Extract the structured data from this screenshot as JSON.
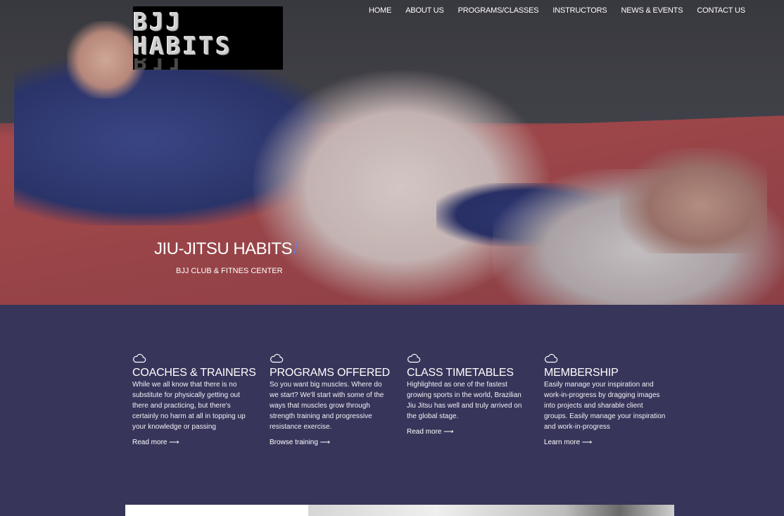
{
  "logo": {
    "text": "BJJ HABITS"
  },
  "nav": {
    "items": [
      "HOME",
      "ABOUT US",
      "PROGRAMS/CLASSES",
      "INSTRUCTORS",
      "NEWS & EVENTS",
      "CONTACT US"
    ]
  },
  "hero": {
    "title": "JIU-JITSU HABITS",
    "slash": "/",
    "subtitle": "BJJ CLUB & FITNES CENTER"
  },
  "features": [
    {
      "icon": "cloud-icon",
      "title": "COACHES & TRAINERS",
      "body": "While we all know that there is no substitute for physically getting out there and practicing, but there's certainly no harm at all in topping up your knowledge or passing",
      "link": "Read more ⟶"
    },
    {
      "icon": "cloud-icon",
      "title": "PROGRAMS OFFERED",
      "body": "So you want big muscles. Where do we start? We'll start with some of the ways that muscles grow through strength training and progressive resistance exercise.",
      "link": "Browse training ⟶"
    },
    {
      "icon": "cloud-icon",
      "title": "CLASS TIMETABLES",
      "body": "Highlighted as one of the fastest growing sports in the world, Brazilian Jiu Jitsu has well and truly arrived on the global stage.",
      "link": "Read more ⟶"
    },
    {
      "icon": "cloud-icon",
      "title": "MEMBERSHIP",
      "body": "Easily manage your inspiration and work-in-progress by dragging images into projects and sharable client groups. Easily manage your inspiration and work-in-progress",
      "link": "Learn more ⟶"
    }
  ],
  "colors": {
    "section_bg": "#37355a",
    "accent": "#6a78d8"
  }
}
